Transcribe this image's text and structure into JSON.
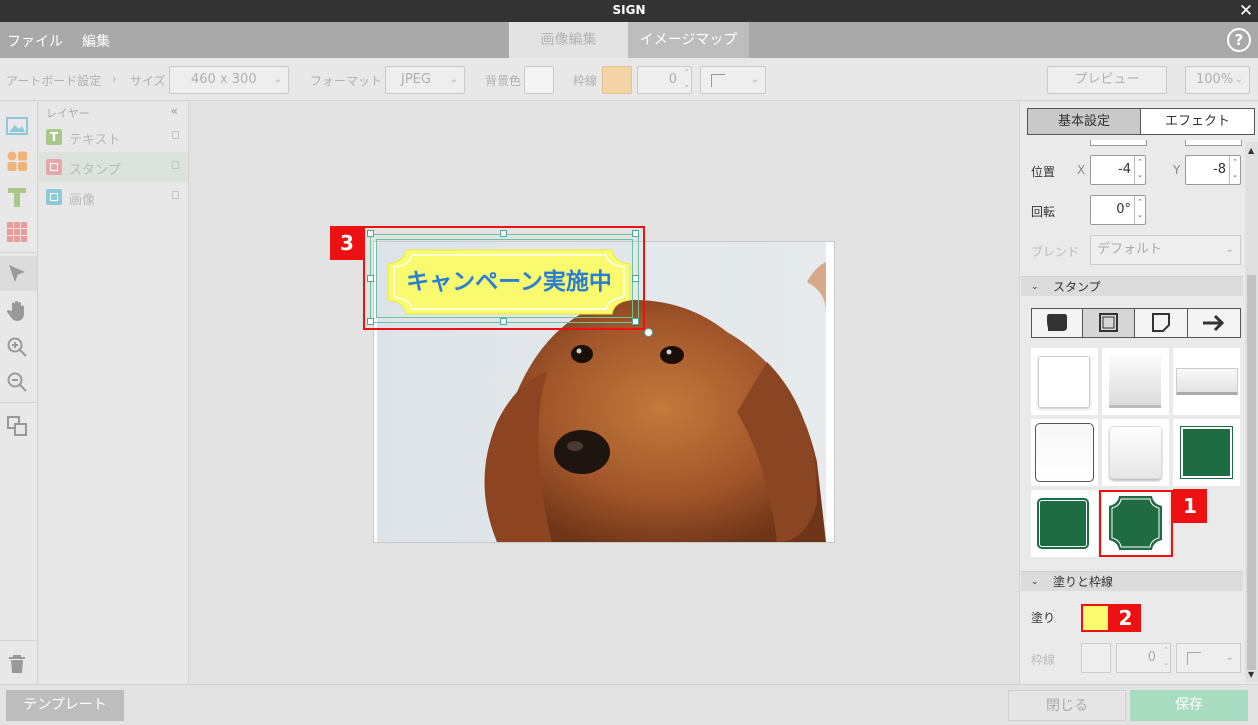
{
  "app": {
    "title": "SIGN"
  },
  "menu": {
    "file": "ファイル",
    "edit": "編集"
  },
  "tabs": {
    "image_edit": "画像編集",
    "image_map": "イメージマップ"
  },
  "help_glyph": "?",
  "close_glyph": "✕",
  "toolbar": {
    "artboard_label": "アートボード設定",
    "sep": "›",
    "size_label": "サイズ",
    "size_value": "460 x 300",
    "format_label": "フォーマット",
    "format_value": "JPEG",
    "bg_label": "背景色",
    "border_label": "枠線",
    "border_width": "0",
    "preview": "プレビュー",
    "zoom": "100%"
  },
  "layers": {
    "title": "レイヤー",
    "collapse": "«",
    "items": [
      {
        "label": "テキスト",
        "color": "#a8c987"
      },
      {
        "label": "スタンプ",
        "color": "#e6a8a8"
      },
      {
        "label": "画像",
        "color": "#8fc9d9"
      }
    ]
  },
  "canvas": {
    "stamp_text": "キャンペーン実施中",
    "stamp_fill": "#fafa6e",
    "stamp_text_color": "#2a7fd4"
  },
  "right": {
    "tab_basic": "基本設定",
    "tab_effect": "エフェクト",
    "position_label": "位置",
    "x_label": "X",
    "x_value": "-4",
    "y_label": "Y",
    "y_value": "-8",
    "rotation_label": "回転",
    "rotation_value": "0°",
    "blend_label": "ブレンド",
    "blend_value": "デフォルト",
    "stamp_section": "スタンプ",
    "fill_section": "塗りと枠線",
    "fill_label": "塗り",
    "fill_color": "#fafa6e",
    "stroke_label": "枠線",
    "stroke_width": "0",
    "accent": "#1f6b42"
  },
  "annotations": {
    "one": "1",
    "two": "2",
    "three": "3"
  },
  "bottom": {
    "template": "テンプレート",
    "close": "閉じる",
    "save": "保存"
  }
}
